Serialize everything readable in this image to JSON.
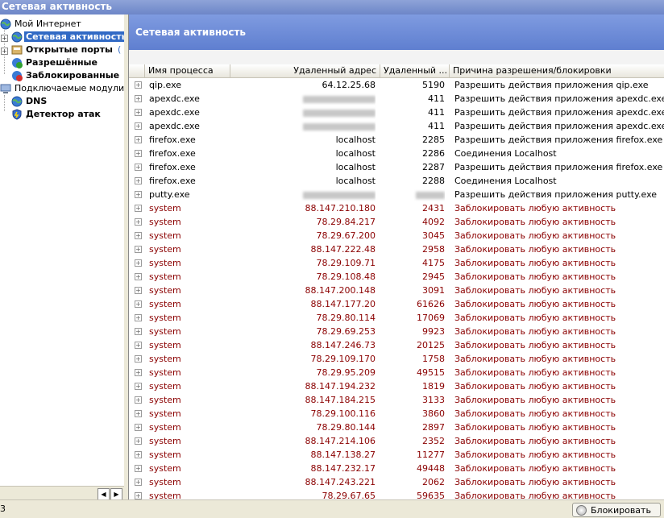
{
  "window": {
    "title": "Сетевая активность"
  },
  "tree": {
    "root": "Мой Интернет",
    "items": [
      {
        "label": "Сетевая активность",
        "selected": true
      },
      {
        "label": "Открытые порты",
        "suffix": "("
      },
      {
        "label": "Разрешённые"
      },
      {
        "label": "Заблокированные"
      }
    ],
    "modules_root": "Подключаемые модули",
    "modules": [
      {
        "label": "DNS"
      },
      {
        "label": "Детектор атак"
      }
    ]
  },
  "panel": {
    "header": "Сетевая активность",
    "columns": [
      "Имя процесса",
      "Удаленный адрес",
      "Удаленный ...",
      "Причина разрешения/блокировки"
    ],
    "rows": [
      {
        "process": "qip.exe",
        "address": "64.12.25.68",
        "port": "5190",
        "reason": "Разрешить действия приложения qip.exe",
        "blocked": false,
        "hidden": false
      },
      {
        "process": "apexdc.exe",
        "address": "",
        "port": "411",
        "reason": "Разрешить действия приложения apexdc.exe",
        "blocked": false,
        "hidden": true
      },
      {
        "process": "apexdc.exe",
        "address": "",
        "port": "411",
        "reason": "Разрешить действия приложения apexdc.exe",
        "blocked": false,
        "hidden": true
      },
      {
        "process": "apexdc.exe",
        "address": "",
        "port": "411",
        "reason": "Разрешить действия приложения apexdc.exe",
        "blocked": false,
        "hidden": true
      },
      {
        "process": "firefox.exe",
        "address": "localhost",
        "port": "2285",
        "reason": "Разрешить действия приложения firefox.exe",
        "blocked": false,
        "hidden": false
      },
      {
        "process": "firefox.exe",
        "address": "localhost",
        "port": "2286",
        "reason": "Соединения Localhost",
        "blocked": false,
        "hidden": false
      },
      {
        "process": "firefox.exe",
        "address": "localhost",
        "port": "2287",
        "reason": "Разрешить действия приложения firefox.exe",
        "blocked": false,
        "hidden": false
      },
      {
        "process": "firefox.exe",
        "address": "localhost",
        "port": "2288",
        "reason": "Соединения Localhost",
        "blocked": false,
        "hidden": false
      },
      {
        "process": "putty.exe",
        "address": "",
        "port": "",
        "reason": "Разрешить действия приложения putty.exe",
        "blocked": false,
        "hidden": true
      },
      {
        "process": "system",
        "address": "88.147.210.180",
        "port": "2431",
        "reason": "Заблокировать любую активность",
        "blocked": true
      },
      {
        "process": "system",
        "address": "78.29.84.217",
        "port": "4092",
        "reason": "Заблокировать любую активность",
        "blocked": true
      },
      {
        "process": "system",
        "address": "78.29.67.200",
        "port": "3045",
        "reason": "Заблокировать любую активность",
        "blocked": true
      },
      {
        "process": "system",
        "address": "88.147.222.48",
        "port": "2958",
        "reason": "Заблокировать любую активность",
        "blocked": true
      },
      {
        "process": "system",
        "address": "78.29.109.71",
        "port": "4175",
        "reason": "Заблокировать любую активность",
        "blocked": true
      },
      {
        "process": "system",
        "address": "78.29.108.48",
        "port": "2945",
        "reason": "Заблокировать любую активность",
        "blocked": true
      },
      {
        "process": "system",
        "address": "88.147.200.148",
        "port": "3091",
        "reason": "Заблокировать любую активность",
        "blocked": true
      },
      {
        "process": "system",
        "address": "88.147.177.20",
        "port": "61626",
        "reason": "Заблокировать любую активность",
        "blocked": true
      },
      {
        "process": "system",
        "address": "78.29.80.114",
        "port": "17069",
        "reason": "Заблокировать любую активность",
        "blocked": true
      },
      {
        "process": "system",
        "address": "78.29.69.253",
        "port": "9923",
        "reason": "Заблокировать любую активность",
        "blocked": true
      },
      {
        "process": "system",
        "address": "88.147.246.73",
        "port": "20125",
        "reason": "Заблокировать любую активность",
        "blocked": true
      },
      {
        "process": "system",
        "address": "78.29.109.170",
        "port": "1758",
        "reason": "Заблокировать любую активность",
        "blocked": true
      },
      {
        "process": "system",
        "address": "78.29.95.209",
        "port": "49515",
        "reason": "Заблокировать любую активность",
        "blocked": true
      },
      {
        "process": "system",
        "address": "88.147.194.232",
        "port": "1819",
        "reason": "Заблокировать любую активность",
        "blocked": true
      },
      {
        "process": "system",
        "address": "88.147.184.215",
        "port": "3133",
        "reason": "Заблокировать любую активность",
        "blocked": true
      },
      {
        "process": "system",
        "address": "78.29.100.116",
        "port": "3860",
        "reason": "Заблокировать любую активность",
        "blocked": true
      },
      {
        "process": "system",
        "address": "78.29.80.144",
        "port": "2897",
        "reason": "Заблокировать любую активность",
        "blocked": true
      },
      {
        "process": "system",
        "address": "88.147.214.106",
        "port": "2352",
        "reason": "Заблокировать любую активность",
        "blocked": true
      },
      {
        "process": "system",
        "address": "88.147.138.27",
        "port": "11277",
        "reason": "Заблокировать любую активность",
        "blocked": true
      },
      {
        "process": "system",
        "address": "88.147.232.17",
        "port": "49448",
        "reason": "Заблокировать любую активность",
        "blocked": true
      },
      {
        "process": "system",
        "address": "88.147.243.221",
        "port": "2062",
        "reason": "Заблокировать любую активность",
        "blocked": true
      },
      {
        "process": "system",
        "address": "78.29.67.65",
        "port": "59635",
        "reason": "Заблокировать любую активность",
        "blocked": true
      }
    ]
  },
  "status": {
    "left_text": "3",
    "block_button": "Блокировать"
  },
  "colors": {
    "blocked_text": "#8b0000",
    "selection": "#316ac5",
    "header_blue": "#6d86c8"
  },
  "icons": {
    "root": "globe-icon",
    "network": "globe-icon",
    "ports": "ports-icon",
    "allowed": "allowed-icon",
    "blocked": "blocked-icon",
    "modules": "computer-icon",
    "dns": "globe-icon",
    "detector": "shield-icon",
    "block_button": "block-icon"
  }
}
